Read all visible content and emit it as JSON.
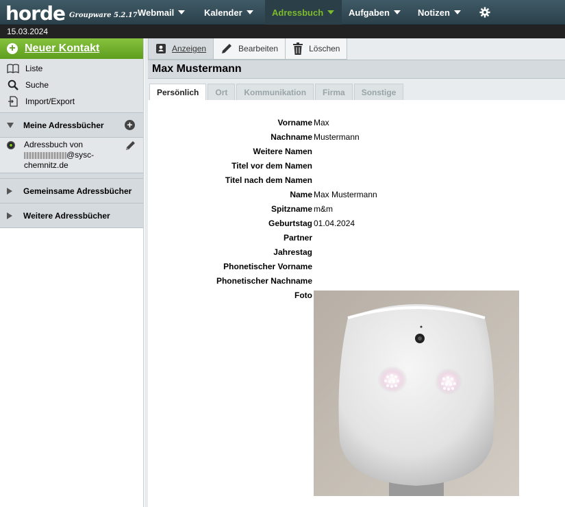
{
  "app": {
    "logo": "horde",
    "version_label": "Groupware 5.2.17",
    "date": "15.03.2024"
  },
  "nav": {
    "items": [
      {
        "label": "Webmail"
      },
      {
        "label": "Kalender"
      },
      {
        "label": "Adressbuch",
        "active": true
      },
      {
        "label": "Aufgaben"
      },
      {
        "label": "Notizen"
      }
    ],
    "settings_icon": "gear-icon"
  },
  "sidebar": {
    "new_contact_label": "Neuer Kontakt",
    "actions": [
      {
        "label": "Liste",
        "icon": "book-icon"
      },
      {
        "label": "Suche",
        "icon": "search-icon"
      },
      {
        "label": "Import/Export",
        "icon": "import-export-icon"
      }
    ],
    "sections": {
      "mine": "Meine Adressbücher",
      "shared": "Gemeinsame Adressbücher",
      "other": "Weitere Adressbücher"
    },
    "addressbook": {
      "line1": "Adressbuch von",
      "line2_suffix": "@sysc-",
      "line3": "chemnitz.de"
    }
  },
  "toolbar": {
    "view_label": "Anzeigen",
    "edit_label": "Bearbeiten",
    "delete_label": "Löschen"
  },
  "contact": {
    "title": "Max Mustermann",
    "tabs": [
      "Persönlich",
      "Ort",
      "Kommunikation",
      "Firma",
      "Sonstige"
    ],
    "fields": [
      {
        "label": "Vorname",
        "value": "Max"
      },
      {
        "label": "Nachname",
        "value": "Mustermann"
      },
      {
        "label": "Weitere Namen",
        "value": ""
      },
      {
        "label": "Titel vor dem Namen",
        "value": ""
      },
      {
        "label": "Titel nach dem Namen",
        "value": ""
      },
      {
        "label": "Name",
        "value": "Max Mustermann"
      },
      {
        "label": "Spitzname",
        "value": "m&m"
      },
      {
        "label": "Geburtstag",
        "value": "01.04.2024"
      },
      {
        "label": "Partner",
        "value": ""
      },
      {
        "label": "Jahrestag",
        "value": ""
      },
      {
        "label": "Phonetischer Vorname",
        "value": ""
      },
      {
        "label": "Phonetischer Nachname",
        "value": ""
      },
      {
        "label": "Foto",
        "value": ""
      }
    ]
  },
  "colors": {
    "nav_bg": "#34505c",
    "accent_green": "#7dbb2e",
    "sidebar_bg": "#d4dadd"
  }
}
